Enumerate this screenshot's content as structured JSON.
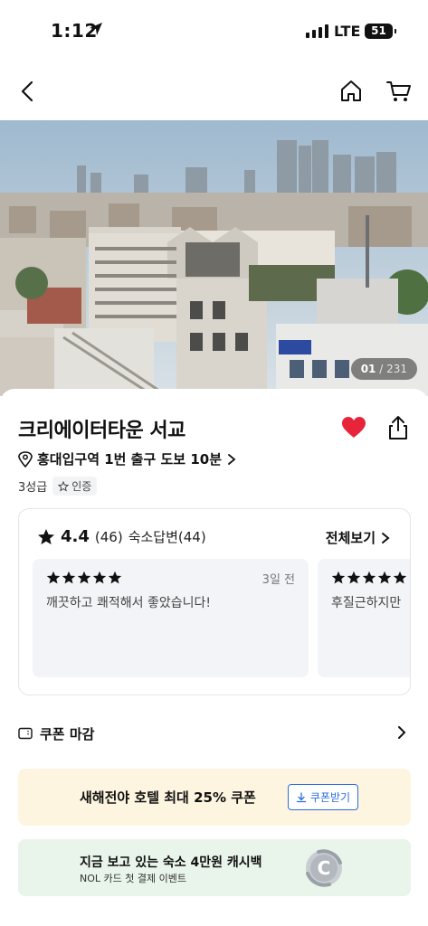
{
  "status_bar": {
    "time": "1:12",
    "network": "LTE",
    "battery": "51"
  },
  "nav": {
    "back_icon": "chevron-left-icon",
    "home_icon": "home-icon",
    "cart_icon": "cart-icon"
  },
  "gallery": {
    "current": "01",
    "total": "/ 231"
  },
  "hotel": {
    "name": "크리에이터타운 서교",
    "location": "홍대입구역 1번 출구 도보 10분",
    "grade": "3성급",
    "badge": "인증",
    "liked": true
  },
  "reviews": {
    "rating": "4.4",
    "count": "(46)",
    "replies": "숙소답변(44)",
    "view_all": "전체보기",
    "items": [
      {
        "stars": 5,
        "date": "3일 전",
        "text": "깨끗하고 쾌적해서 좋았습니다!"
      },
      {
        "stars": 5,
        "date": "",
        "text": "후질근하지만"
      }
    ]
  },
  "coupon": {
    "label": "쿠폰 마감"
  },
  "promos": [
    {
      "text": "새해전야 호텔 최대 25% 쿠폰",
      "button": "쿠폰받기"
    },
    {
      "title": "지금 보고 있는 숙소 4만원 캐시백",
      "subtitle": "NOL 카드 첫 결제 이벤트"
    }
  ],
  "colors": {
    "accent": "#e8243a",
    "link": "#2b6cde",
    "promo_yellow": "#fdf5df",
    "promo_green": "#e9f4ea"
  }
}
